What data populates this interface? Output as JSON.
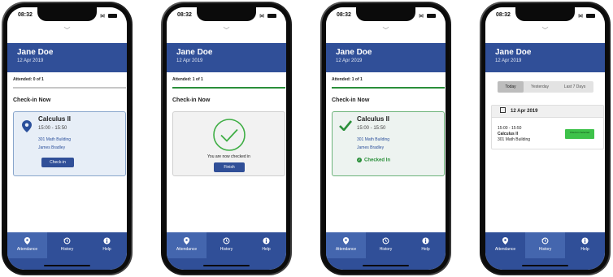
{
  "status_time": "08:32",
  "user": {
    "name": "Jane Doe",
    "date": "12 Apr 2019"
  },
  "tabs": {
    "attendance": "Attendance",
    "history": "History",
    "help": "Help"
  },
  "screen1": {
    "attended": "Attended: 0 of 1",
    "progress": 0,
    "section": "Check-in Now",
    "course": "Calculus II",
    "time": "15:00 - 15:50",
    "location": "301 Math Building",
    "professor": "James Bradley",
    "button": "Check-in"
  },
  "screen2": {
    "attended": "Attended: 1 of 1",
    "progress": 1,
    "section": "Check-in Now",
    "message": "You are now checked in",
    "button": "Finish"
  },
  "screen3": {
    "attended": "Attended: 1 of 1",
    "progress": 1,
    "section": "Check-in Now",
    "course": "Calculus II",
    "time": "15:00 - 15:50",
    "location": "301 Math Building",
    "professor": "James Bradley",
    "status": "Checked In"
  },
  "screen4": {
    "segments": [
      "Today",
      "Yesterday",
      "Last 7 Days"
    ],
    "selected_segment": "Today",
    "day": "12 Apr 2019",
    "time": "15:00 - 15:50",
    "course": "Calculus II",
    "location": "301 Math Building",
    "badge": "Check-in Selected"
  },
  "colors": {
    "brand": "#304f98",
    "success": "#2a8f3a"
  }
}
